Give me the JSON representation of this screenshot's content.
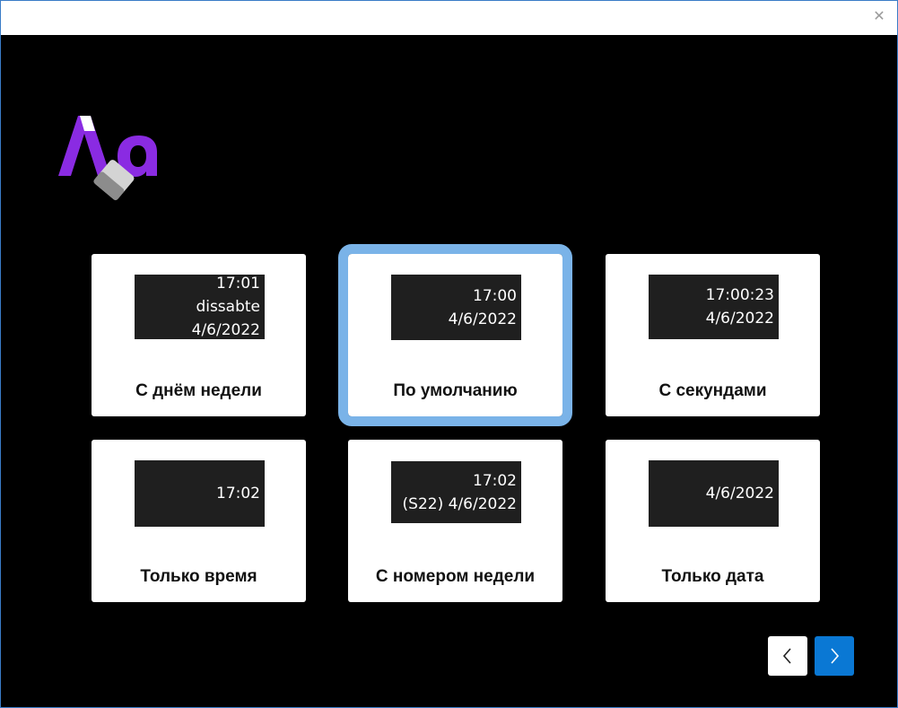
{
  "window": {
    "close_glyph": "✕"
  },
  "icons": {
    "logo": "font-settings-logo-icon",
    "close": "close-icon",
    "prev": "chevron-left-icon",
    "next": "chevron-right-icon"
  },
  "colors": {
    "accent": "#0a78d4",
    "selected_outline": "#7ab3e8",
    "logo_purple": "#8a2be2"
  },
  "options": [
    {
      "label": "С днём недели",
      "preview": [
        "17:01",
        "dissabte",
        "4/6/2022"
      ],
      "selected": false
    },
    {
      "label": "По умолчанию",
      "preview": [
        "17:00",
        "4/6/2022"
      ],
      "selected": true
    },
    {
      "label": "С секундами",
      "preview": [
        "17:00:23",
        "4/6/2022"
      ],
      "selected": false
    },
    {
      "label": "Только время",
      "preview": [
        "17:02"
      ],
      "selected": false
    },
    {
      "label": "С номером недели",
      "preview": [
        "17:02",
        "(S22) 4/6/2022"
      ],
      "selected": false
    },
    {
      "label": "Только дата",
      "preview": [
        "4/6/2022"
      ],
      "selected": false
    }
  ]
}
